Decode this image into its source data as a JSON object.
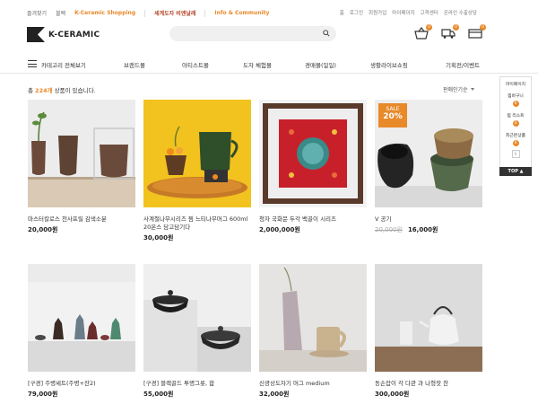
{
  "top": {
    "left_links": [
      "즐겨찾기",
      "블랙",
      "K-Ceramic Shopping",
      "세계도자 비엔날레",
      "Info & Community"
    ],
    "right_links": [
      "홈",
      "로그인",
      "회원가입",
      "마이페이지",
      "고객센터",
      "온라인 수출상담"
    ]
  },
  "logo": {
    "text": "K-CERAMIC"
  },
  "search": {
    "placeholder": ""
  },
  "header": {
    "cart_count": "0",
    "wish_count": "0",
    "recent_count": "0"
  },
  "nav": {
    "all_categories": "카테고리 전체보기",
    "items": [
      "브랜드몰",
      "아티스트몰",
      "도자 체험몰",
      "경매몰(일일)",
      "생활라이브쇼핑",
      "기획전/이벤트"
    ]
  },
  "listing": {
    "count_prefix": "총 ",
    "count": "224개",
    "count_suffix": " 상품이 있습니다.",
    "sort_label": "판매인기순"
  },
  "sidepanel": {
    "title": "마이페이지",
    "wish_label": "찜바구니",
    "wish_count": "0",
    "cart_label": "찜 리스트",
    "cart_count": "0",
    "recent_label": "최근본상품",
    "recent_count": "0",
    "recent_box": "X",
    "top_button": "TOP ▲"
  },
  "products": [
    {
      "name": "마스터칼로스 천사프릴 감색소분",
      "price": "20,000원"
    },
    {
      "name": "사계절나무시리즈 찜 느티나무머그 600ml 20온스 담고담기다",
      "price": "30,000원"
    },
    {
      "name": "청자 국화문 두각 백골이 시리즈",
      "price": "2,000,000원"
    },
    {
      "name": "V 공기",
      "orig_price": "20,000원",
      "price": "16,000원",
      "sale_label": "SALE",
      "sale_percent": "20%"
    },
    {
      "name": "[구경] 주병세트(주병+잔2)",
      "price": "79,000원"
    },
    {
      "name": "[구경] 블랙골드 투명그릇, 합",
      "price": "55,000원"
    },
    {
      "name": "신광상도자기 머그 medium",
      "price": "32,000원"
    },
    {
      "name": "동손잡이 각 다관 과 나형잣 찬",
      "price": "300,000원"
    }
  ]
}
